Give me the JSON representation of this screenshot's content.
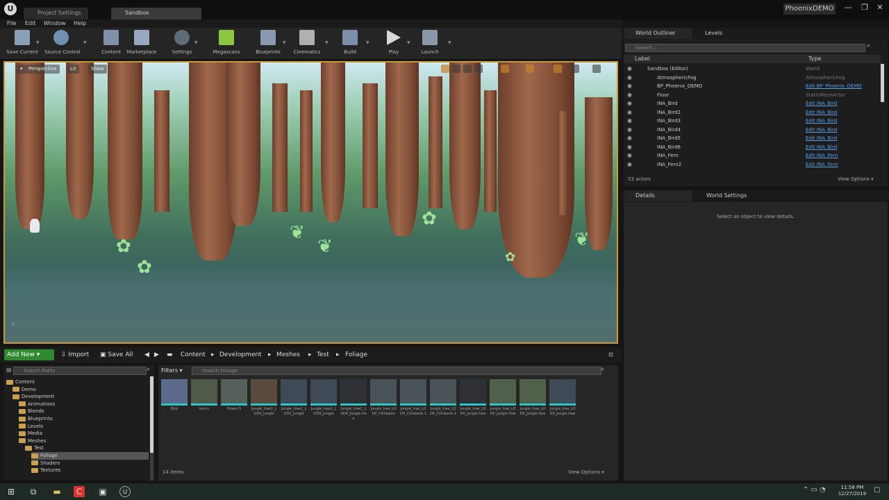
{
  "window": {
    "tabs": [
      "Project Settings",
      "Sandbox"
    ],
    "project_name": "PhoenixDEMO",
    "buttons": [
      "—",
      "❐",
      "✕"
    ]
  },
  "menu": [
    "File",
    "Edit",
    "Window",
    "Help"
  ],
  "toolbar": {
    "buttons": [
      "Save Current",
      "Source Control",
      "Content",
      "Marketplace",
      "Settings",
      "Megascans",
      "Blueprints",
      "Cinematics",
      "Build",
      "Play",
      "Launch"
    ]
  },
  "viewport": {
    "chips": [
      "Perspective",
      "Lit",
      "Show"
    ],
    "axis": "z"
  },
  "content_browser": {
    "add_new": "Add New ▾",
    "import": "Import",
    "save_all": "Save All",
    "breadcrumb": [
      "Content",
      "Development",
      "Meshes",
      "Test",
      "Foliage"
    ],
    "search_paths_placeholder": "Search Paths",
    "filters": "Filters ▾",
    "search_placeholder": "Search Foliage",
    "tree": [
      {
        "label": "Content",
        "indent": 0
      },
      {
        "label": "Demo",
        "indent": 1
      },
      {
        "label": "Development",
        "indent": 1
      },
      {
        "label": "Animations",
        "indent": 2
      },
      {
        "label": "Blends",
        "indent": 2
      },
      {
        "label": "Blueprints",
        "indent": 2
      },
      {
        "label": "Levels",
        "indent": 2
      },
      {
        "label": "Media",
        "indent": 2
      },
      {
        "label": "Meshes",
        "indent": 2
      },
      {
        "label": "Test",
        "indent": 3
      },
      {
        "label": "Foliage",
        "indent": 4
      },
      {
        "label": "Shaders",
        "indent": 4
      },
      {
        "label": "Textures",
        "indent": 4
      }
    ],
    "assets": [
      "Bird",
      "fern-L",
      "flower-S",
      "Jungle_tree2_LOD0_Jungle",
      "Jungle_tree2_LOD0_Jungle",
      "Jungle_tree2_LOD0_Jungle",
      "Jungle_tree2_LOD0_Jungle tree",
      "Jungle_tree_LOD0_Climbane",
      "Jungle_tree_LOD0_Climbane 1",
      "Jungle_tree_LOD0_Climbane 2",
      "Jungle_tree_LOD0_Jungle tree",
      "Jungle_tree_LOD0_Jungle tree",
      "Jungle_tree_LOD0_Jungle tree",
      "Jungle_tree_LOD0_Jungle tree"
    ],
    "item_count": "14 items",
    "view_options": "View Options ▾"
  },
  "outliner": {
    "tab": "World Outliner",
    "tab2": "Levels",
    "search_placeholder": "Search...",
    "col_label": "Label",
    "col_type": "Type",
    "rows": [
      {
        "label": "Sandbox (Editor)",
        "type": "World",
        "link": false
      },
      {
        "label": "AtmosphericFog",
        "type": "AtmosphericFog",
        "link": false
      },
      {
        "label": "BP_Phoenix_DEMO",
        "type": "Edit BP_Phoenix_DEMO",
        "link": true
      },
      {
        "label": "Floor",
        "type": "StaticMeshActor",
        "link": false
      },
      {
        "label": "INA_Bird",
        "type": "Edit INA_Bird",
        "link": true
      },
      {
        "label": "INA_Bird2",
        "type": "Edit INA_Bird",
        "link": true
      },
      {
        "label": "INA_Bird3",
        "type": "Edit INA_Bird",
        "link": true
      },
      {
        "label": "INA_Bird4",
        "type": "Edit INA_Bird",
        "link": true
      },
      {
        "label": "INA_Bird5",
        "type": "Edit INA_Bird",
        "link": true
      },
      {
        "label": "INA_Bird6",
        "type": "Edit INA_Bird",
        "link": true
      },
      {
        "label": "INA_Fern",
        "type": "Edit INA_Fern",
        "link": true
      },
      {
        "label": "INA_Fern2",
        "type": "Edit INA_Fern",
        "link": true
      }
    ],
    "actor_count": "53 actors",
    "view_options": "View Options ▾"
  },
  "details": {
    "tab": "Details",
    "tab2": "World Settings",
    "empty_text": "Select an object to view details."
  },
  "taskbar": {
    "time": "11:58 PM",
    "date": "12/27/2019"
  }
}
